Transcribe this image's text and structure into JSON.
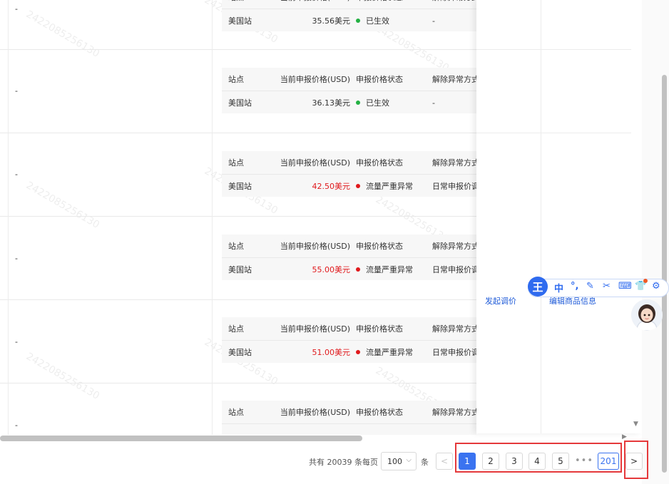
{
  "table": {
    "sub_headers": {
      "site": "站点",
      "price": "当前申报价格(USD)",
      "status": "申报价格状态",
      "method": "解除异常方式"
    },
    "rows": [
      {
        "dash": "-",
        "site": "美国站",
        "price": "35.56美元",
        "status": "已生效",
        "method": "-",
        "status_color": "#23b043"
      },
      {
        "dash": "-",
        "site": "美国站",
        "price": "36.13美元",
        "status": "已生效",
        "method": "-",
        "status_color": "#23b043"
      },
      {
        "dash": "-",
        "site": "美国站",
        "price": "42.50美元",
        "status": "流量严重异常",
        "method": "日常申报价调",
        "status_color": "#e0191c"
      },
      {
        "dash": "-",
        "site": "美国站",
        "price": "55.00美元",
        "status": "流量严重异常",
        "method": "日常申报价调",
        "status_color": "#e0191c"
      },
      {
        "dash": "-",
        "site": "美国站",
        "price": "51.00美元",
        "status": "流量严重异常",
        "method": "日常申报价调",
        "status_color": "#e0191c"
      },
      {
        "dash": "-",
        "site": "",
        "price": "",
        "status": "",
        "method": "",
        "status_color": ""
      }
    ]
  },
  "actions": {
    "adjust_price": "发起调价",
    "edit_product": "编辑商品信息"
  },
  "pagination": {
    "total": "共有 20039 条",
    "per_page_label": "每页",
    "page_size": "100",
    "unit": "条",
    "prev": "<",
    "pages": [
      "1",
      "2",
      "3",
      "4",
      "5"
    ],
    "ellipsis": "•••",
    "last": "201",
    "next": ">",
    "active_page": "1"
  },
  "ime": {
    "logo": "王",
    "lang": "中",
    "punct": "°,",
    "pen": "✎",
    "cut": "✂",
    "keyboard": "⌨",
    "skin": "👕",
    "settings": "⚙"
  },
  "watermark": "2422085256130"
}
